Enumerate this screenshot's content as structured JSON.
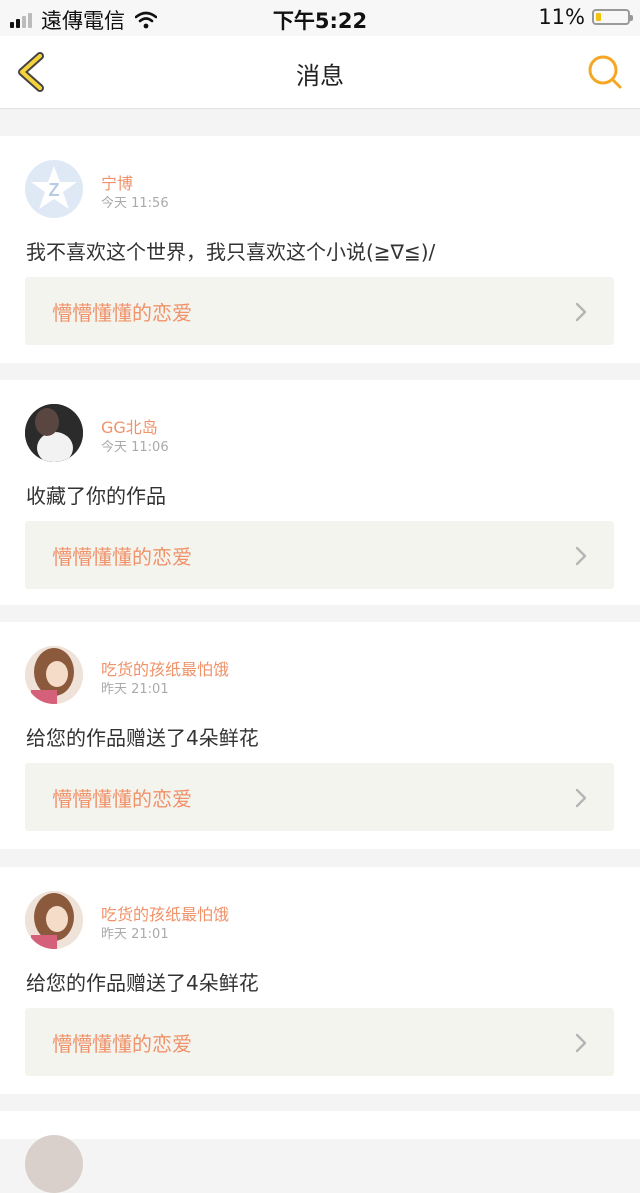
{
  "status_bar": {
    "carrier": "遠傳電信",
    "time": "下午5:22",
    "battery": "11%",
    "battery_level": 0.11
  },
  "nav": {
    "title": "消息",
    "accent_color": "#f5a623"
  },
  "messages": [
    {
      "name": "宁博",
      "time": "今天 11:56",
      "text": "我不喜欢这个世界，我只喜欢这个小说(≧∇≦)/",
      "work": "懵懵懂懂的恋爱",
      "avatar": "qq-default-avatar"
    },
    {
      "name": "GG北岛",
      "time": "今天 11:06",
      "text": "收藏了你的作品",
      "work": "懵懵懂懂的恋爱",
      "avatar": "user-photo-avatar"
    },
    {
      "name": "吃货的孩纸最怕饿",
      "time": "昨天 21:01",
      "text": "给您的作品赠送了4朵鲜花",
      "work": "懵懵懂懂的恋爱",
      "avatar": "user-photo-avatar"
    },
    {
      "name": "吃货的孩纸最怕饿",
      "time": "昨天 21:01",
      "text": "给您的作品赠送了4朵鲜花",
      "work": "懵懵懂懂的恋爱",
      "avatar": "user-photo-avatar"
    }
  ],
  "colors": {
    "name": "#f0926a",
    "work_bg": "#f4f4ef",
    "divider_bg": "#f4f4f4"
  }
}
